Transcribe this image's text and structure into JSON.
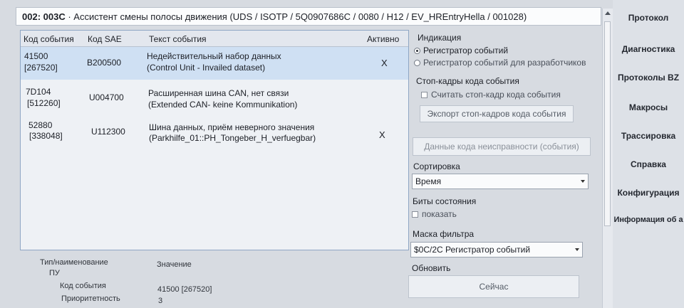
{
  "window": {
    "title_prefix": "002: 003C",
    "title_rest": " · Ассистент смены полосы движения  (UDS / ISOTP / 5Q0907686C / 0080 / H12 / EV_HREntryHella / 001028)"
  },
  "events_table": {
    "headers": {
      "code": "Код события",
      "sae": "Код SAE",
      "text": "Текст события",
      "active": "Активно"
    },
    "rows": [
      {
        "code": "41500",
        "code_dec": "[267520]",
        "sae": "B200500",
        "text_ru": "Недействительный набор данных",
        "text_en": "(Control Unit - Invailed dataset)",
        "active": "X"
      },
      {
        "code": "7D104",
        "code_dec": "[512260]",
        "sae": "U004700",
        "text_ru": "Расширенная шина CAN, нет связи",
        "text_en": "(Extended CAN- keine Kommunikation)",
        "active": ""
      },
      {
        "code": "52880",
        "code_dec": "[338048]",
        "sae": "U112300",
        "text_ru": "Шина данных, приём неверного значения",
        "text_en": "(Parkhilfe_01::PH_Tongeber_H_verfuegbar)",
        "active": "X"
      }
    ]
  },
  "details": {
    "col_type": "Тип/наименование",
    "col_value": "Значение",
    "group": "ПУ",
    "rows": [
      {
        "name": "Код события",
        "value": "41500 [267520]"
      },
      {
        "name": "Приоритетность",
        "value": "3"
      }
    ]
  },
  "side": {
    "indication_label": "Индикация",
    "radio_event_recorder": "Регистратор событий",
    "radio_dev_recorder": "Регистратор событий для разработчиков",
    "freeze_label": "Стоп-кадры кода события",
    "freeze_checkbox": "Считать стоп-кадр кода события",
    "export_button": "Экспорт стоп-кадров кода события",
    "fault_data_button": "Данные кода неисправности (события)",
    "sort_label": "Сортировка",
    "sort_value": "Время",
    "status_bits_label": "Биты состояния",
    "status_bits_checkbox": "показать",
    "filter_label": "Маска фильтра",
    "filter_value": "$0C/2C Регистратор событий",
    "refresh_label": "Обновить",
    "now_button": "Сейчас"
  },
  "nav": {
    "items": [
      "Протокол",
      "Диагностика",
      "Протоколы BZ",
      "Макросы",
      "Трассировка",
      "Справка",
      "Конфигурация",
      "Информация об а"
    ]
  }
}
